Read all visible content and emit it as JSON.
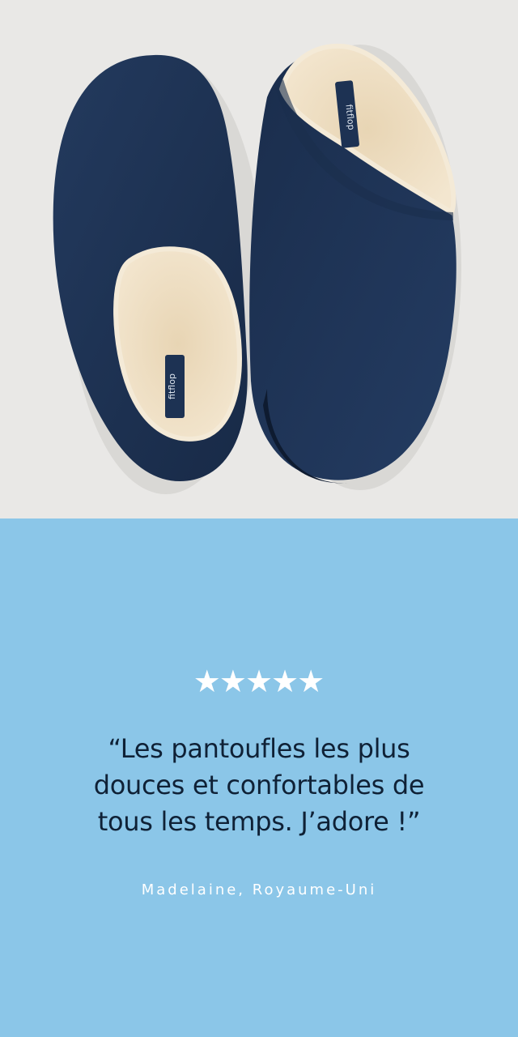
{
  "hero": {
    "image_alt": "Navy suede slippers with shearling lining",
    "brand_tag": "fitflop",
    "colors": {
      "background": "#e9e8e6",
      "suede": "#1d3253",
      "shearling": "#ecdcc0"
    }
  },
  "review": {
    "rating": 5,
    "rating_max": 5,
    "stars": [
      "★",
      "★",
      "★",
      "★",
      "★"
    ],
    "quote_lines": [
      "“Les pantoufles les plus",
      "douces et confortables de",
      "tous les temps. J’adore !”"
    ],
    "author": "Madelaine, Royaume-Uni",
    "colors": {
      "background": "#8bc6e8",
      "text": "#0f2136",
      "accent": "#ffffff"
    }
  }
}
